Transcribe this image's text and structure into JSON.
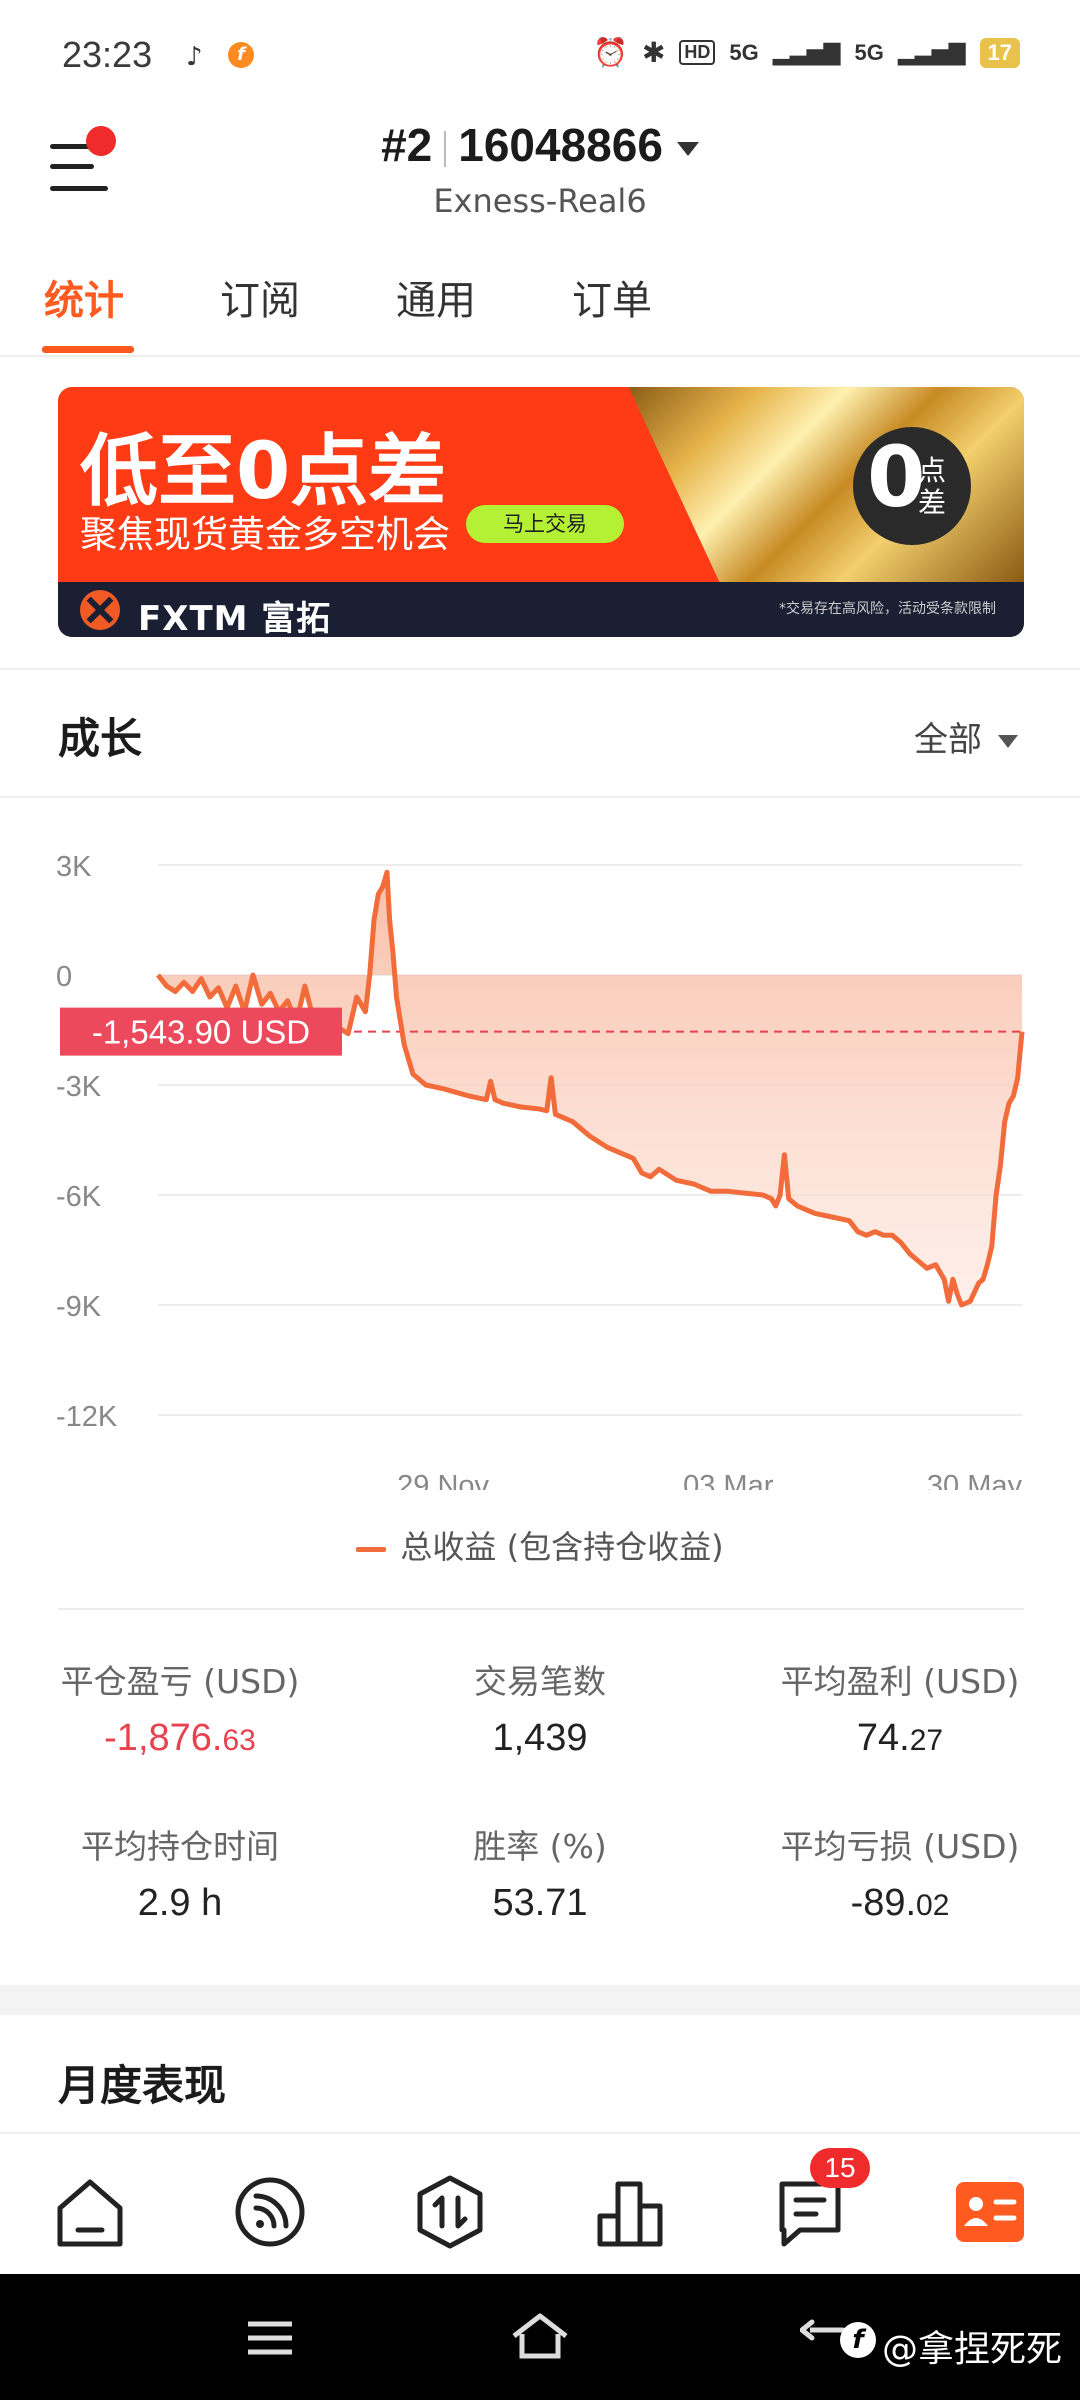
{
  "status_bar": {
    "time": "23:23",
    "network_1": "5G",
    "network_2": "5G",
    "battery": "17",
    "icons": [
      "music-icon",
      "app-f-icon",
      "alarm-icon",
      "bluetooth-icon",
      "hd-icon",
      "signal-icon",
      "signal-icon",
      "battery-icon"
    ]
  },
  "header": {
    "account_number_prefix": "#2",
    "account_number": "16048866",
    "server": "Exness-Real6"
  },
  "tabs": [
    {
      "label": "统计",
      "active": true
    },
    {
      "label": "订阅",
      "active": false
    },
    {
      "label": "通用",
      "active": false
    },
    {
      "label": "订单",
      "active": false
    }
  ],
  "banner": {
    "headline": "低至0点差",
    "subline": "聚焦现货黄金多空机会",
    "button": "马上交易",
    "zero_big": "0",
    "zero_small": "点差",
    "brand": "FXTM 富拓",
    "disclaimer": "*交易存在高风险，活动受条款限制",
    "colors": {
      "bg": "#ff3b16",
      "footer": "#1b1f33",
      "button": "#b4f134"
    }
  },
  "growth": {
    "title": "成长",
    "filter": "全部"
  },
  "chart_data": {
    "type": "area",
    "y_ticks": [
      "3K",
      "0",
      "-3K",
      "-6K",
      "-9K",
      "-12K"
    ],
    "ylim": [
      -12000,
      3000
    ],
    "x_ticks": [
      "29 Nov",
      "03 Mar",
      "30 May"
    ],
    "current_value_label": "-1,543.90 USD",
    "current_value": -1543.9,
    "series": [
      {
        "name": "总收益 (包含持仓收益)",
        "color": "#f26b3a",
        "points": [
          [
            0.0,
            0
          ],
          [
            0.01,
            -300
          ],
          [
            0.02,
            -450
          ],
          [
            0.03,
            -200
          ],
          [
            0.04,
            -450
          ],
          [
            0.05,
            -100
          ],
          [
            0.06,
            -600
          ],
          [
            0.07,
            -350
          ],
          [
            0.08,
            -900
          ],
          [
            0.09,
            -300
          ],
          [
            0.1,
            -1000
          ],
          [
            0.11,
            0
          ],
          [
            0.12,
            -800
          ],
          [
            0.13,
            -500
          ],
          [
            0.14,
            -1000
          ],
          [
            0.15,
            -700
          ],
          [
            0.16,
            -1300
          ],
          [
            0.17,
            -300
          ],
          [
            0.18,
            -1200
          ],
          [
            0.19,
            -1400
          ],
          [
            0.2,
            -1300
          ],
          [
            0.22,
            -1600
          ],
          [
            0.23,
            -600
          ],
          [
            0.24,
            -1000
          ],
          [
            0.245,
            0
          ],
          [
            0.25,
            1500
          ],
          [
            0.255,
            2200
          ],
          [
            0.26,
            2400
          ],
          [
            0.265,
            2800
          ],
          [
            0.268,
            1500
          ],
          [
            0.272,
            600
          ],
          [
            0.276,
            -600
          ],
          [
            0.285,
            -1900
          ],
          [
            0.295,
            -2700
          ],
          [
            0.31,
            -3000
          ],
          [
            0.33,
            -3100
          ],
          [
            0.36,
            -3300
          ],
          [
            0.38,
            -3400
          ],
          [
            0.385,
            -2900
          ],
          [
            0.39,
            -3400
          ],
          [
            0.4,
            -3500
          ],
          [
            0.42,
            -3600
          ],
          [
            0.44,
            -3650
          ],
          [
            0.45,
            -3700
          ],
          [
            0.455,
            -2800
          ],
          [
            0.46,
            -3800
          ],
          [
            0.48,
            -4000
          ],
          [
            0.5,
            -4400
          ],
          [
            0.52,
            -4700
          ],
          [
            0.54,
            -4900
          ],
          [
            0.55,
            -5000
          ],
          [
            0.56,
            -5400
          ],
          [
            0.57,
            -5500
          ],
          [
            0.58,
            -5300
          ],
          [
            0.6,
            -5600
          ],
          [
            0.62,
            -5700
          ],
          [
            0.64,
            -5900
          ],
          [
            0.66,
            -5900
          ],
          [
            0.68,
            -5950
          ],
          [
            0.7,
            -6000
          ],
          [
            0.71,
            -6100
          ],
          [
            0.715,
            -6300
          ],
          [
            0.72,
            -6000
          ],
          [
            0.725,
            -4900
          ],
          [
            0.73,
            -6100
          ],
          [
            0.74,
            -6300
          ],
          [
            0.76,
            -6500
          ],
          [
            0.78,
            -6600
          ],
          [
            0.8,
            -6700
          ],
          [
            0.81,
            -7000
          ],
          [
            0.82,
            -7100
          ],
          [
            0.83,
            -7000
          ],
          [
            0.84,
            -7100
          ],
          [
            0.85,
            -7100
          ],
          [
            0.86,
            -7300
          ],
          [
            0.87,
            -7600
          ],
          [
            0.88,
            -7800
          ],
          [
            0.89,
            -8000
          ],
          [
            0.9,
            -7900
          ],
          [
            0.91,
            -8300
          ],
          [
            0.915,
            -8900
          ],
          [
            0.92,
            -8300
          ],
          [
            0.925,
            -8700
          ],
          [
            0.93,
            -9000
          ],
          [
            0.94,
            -8900
          ],
          [
            0.95,
            -8400
          ],
          [
            0.955,
            -8300
          ],
          [
            0.96,
            -7900
          ],
          [
            0.965,
            -7400
          ],
          [
            0.97,
            -6000
          ],
          [
            0.975,
            -5200
          ],
          [
            0.98,
            -4000
          ],
          [
            0.985,
            -3500
          ],
          [
            0.99,
            -3300
          ],
          [
            0.995,
            -2800
          ],
          [
            1.0,
            -1544
          ]
        ]
      }
    ]
  },
  "legend": {
    "label": "总收益 (包含持仓收益)"
  },
  "stats": [
    {
      "label": "平仓盈亏 (USD)",
      "value_main": "-1,876.",
      "value_small": "63",
      "negative": true
    },
    {
      "label": "交易笔数",
      "value_main": "1,439",
      "value_small": "",
      "negative": false
    },
    {
      "label": "平均盈利 (USD)",
      "value_main": "74.",
      "value_small": "27",
      "negative": false
    },
    {
      "label": "平均持仓时间",
      "value_main": "2.9 h",
      "value_small": "",
      "negative": false
    },
    {
      "label": "胜率 (%)",
      "value_main": "53.71",
      "value_small": "",
      "negative": false
    },
    {
      "label": "平均亏损 (USD)",
      "value_main": "-89.",
      "value_small": "02",
      "negative": false
    }
  ],
  "monthly": {
    "title": "月度表现"
  },
  "bottom_nav": {
    "items": [
      "home-icon",
      "feed-icon",
      "trade-icon",
      "rank-icon",
      "messages-icon",
      "profile-card-icon"
    ],
    "messages_badge": "15",
    "active_color": "#ff5a1f"
  },
  "watermark": "@拿捏死死"
}
